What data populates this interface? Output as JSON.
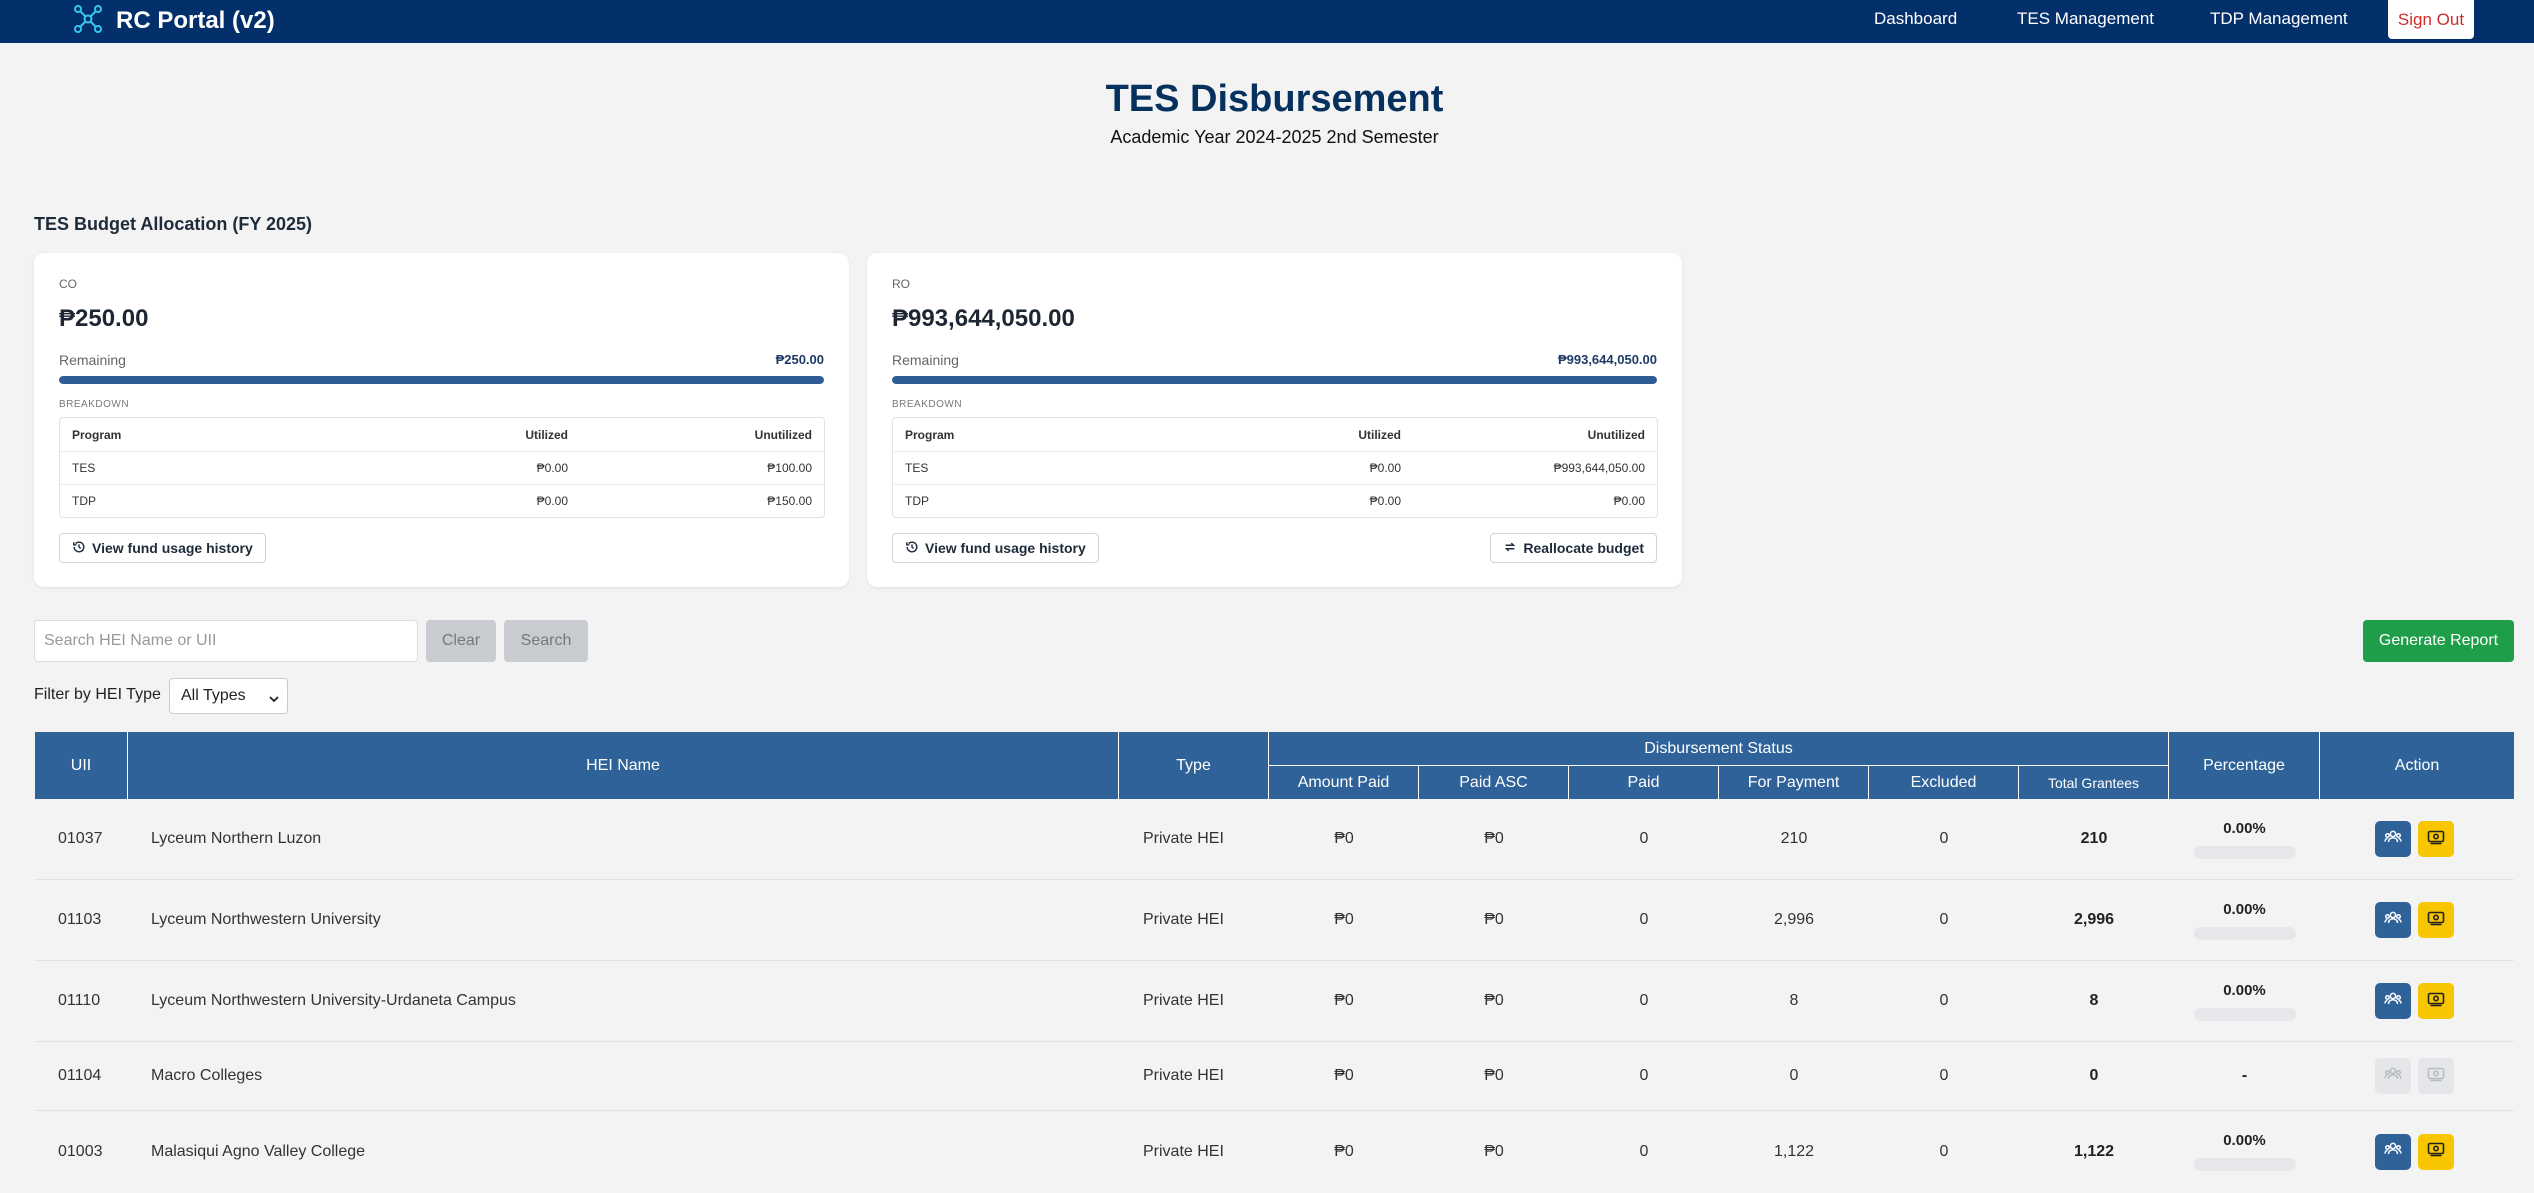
{
  "nav": {
    "brand": "RC Portal (v2)",
    "links": [
      "Dashboard",
      "TES Management",
      "TDP Management"
    ],
    "sign_out": "Sign Out"
  },
  "header": {
    "title": "TES Disbursement",
    "subtitle": "Academic Year 2024-2025 2nd Semester"
  },
  "budget": {
    "section_title": "TES Budget Allocation (FY 2025)",
    "cards": [
      {
        "label": "CO",
        "amount": "₱250.00",
        "remaining_label": "Remaining",
        "remaining_value": "₱250.00",
        "remaining_fraction": 1.0,
        "breakdown_label": "BREAKDOWN",
        "headers": [
          "Program",
          "Utilized",
          "Unutilized"
        ],
        "rows": [
          [
            "TES",
            "₱0.00",
            "₱100.00"
          ],
          [
            "TDP",
            "₱0.00",
            "₱150.00"
          ]
        ],
        "history_btn": "View fund usage history"
      },
      {
        "label": "RO",
        "amount": "₱993,644,050.00",
        "remaining_label": "Remaining",
        "remaining_value": "₱993,644,050.00",
        "remaining_fraction": 1.0,
        "breakdown_label": "BREAKDOWN",
        "headers": [
          "Program",
          "Utilized",
          "Unutilized"
        ],
        "rows": [
          [
            "TES",
            "₱0.00",
            "₱993,644,050.00"
          ],
          [
            "TDP",
            "₱0.00",
            "₱0.00"
          ]
        ],
        "history_btn": "View fund usage history",
        "realloc_btn": "Reallocate budget"
      }
    ]
  },
  "search": {
    "placeholder": "Search HEI Name or UII",
    "clear": "Clear",
    "search": "Search",
    "report": "Generate Report"
  },
  "filter": {
    "label": "Filter by HEI Type",
    "selected": "All Types"
  },
  "table": {
    "headers": {
      "uii": "UII",
      "hei_name": "HEI Name",
      "type": "Type",
      "group": "Disbursement Status",
      "amount_paid": "Amount Paid",
      "paid_asc": "Paid ASC",
      "paid": "Paid",
      "for_payment": "For Payment",
      "excluded": "Excluded",
      "total_grantees": "Total Grantees",
      "percentage": "Percentage",
      "action": "Action"
    },
    "rows": [
      {
        "uii": "01037",
        "name": "Lyceum Northern Luzon",
        "type": "Private HEI",
        "amount_paid": "₱0",
        "paid_asc": "₱0",
        "paid": "0",
        "for_payment": "210",
        "excluded": "0",
        "total": "210",
        "percentage": "0.00%",
        "active": true
      },
      {
        "uii": "01103",
        "name": "Lyceum Northwestern University",
        "type": "Private HEI",
        "amount_paid": "₱0",
        "paid_asc": "₱0",
        "paid": "0",
        "for_payment": "2,996",
        "excluded": "0",
        "total": "2,996",
        "percentage": "0.00%",
        "active": true
      },
      {
        "uii": "01110",
        "name": "Lyceum Northwestern University-Urdaneta Campus",
        "type": "Private HEI",
        "amount_paid": "₱0",
        "paid_asc": "₱0",
        "paid": "0",
        "for_payment": "8",
        "excluded": "0",
        "total": "8",
        "percentage": "0.00%",
        "active": true
      },
      {
        "uii": "01104",
        "name": "Macro Colleges",
        "type": "Private HEI",
        "amount_paid": "₱0",
        "paid_asc": "₱0",
        "paid": "0",
        "for_payment": "0",
        "excluded": "0",
        "total": "0",
        "percentage": "-",
        "active": false
      },
      {
        "uii": "01003",
        "name": "Malasiqui Agno Valley College",
        "type": "Private HEI",
        "amount_paid": "₱0",
        "paid_asc": "₱0",
        "paid": "0",
        "for_payment": "1,122",
        "excluded": "0",
        "total": "1,122",
        "percentage": "0.00%",
        "active": true
      }
    ]
  },
  "icons": {
    "brand": "network-nodes-icon",
    "history": "history-icon",
    "reallocate": "swap-arrows-icon",
    "view": "users-icon",
    "pay": "payment-icon"
  },
  "colors": {
    "navbar": "#03306a",
    "table_header": "#2f6299",
    "report_button": "#1f9e49",
    "action_yellow": "#f7c600",
    "sign_out_text": "#d12c2c"
  }
}
